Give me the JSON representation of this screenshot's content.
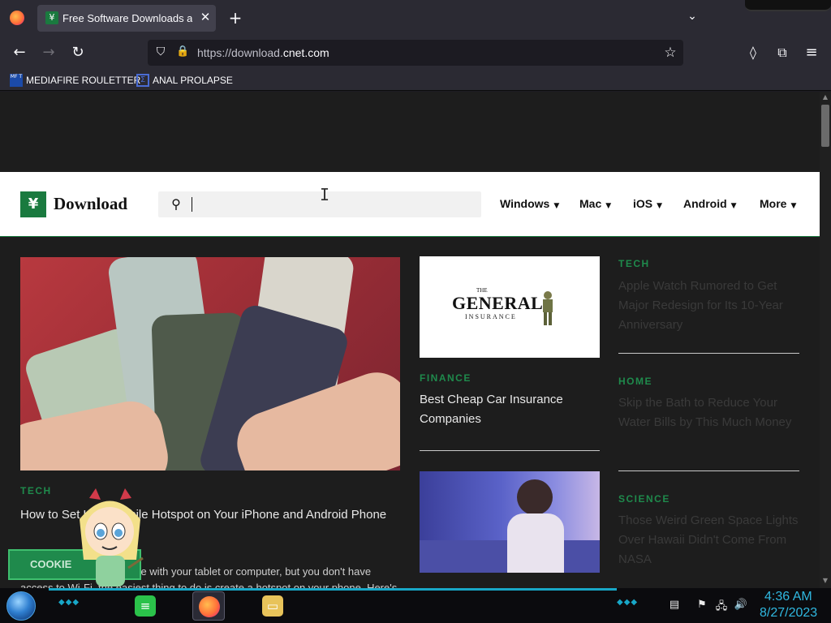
{
  "tab": {
    "title": "Free Software Downloads and Reviews for Windows, Android, Mac, and iOS - CNET Download",
    "close": "✕",
    "favicon": "¥"
  },
  "tabstrip": {
    "newtab": "+",
    "list": "⌄"
  },
  "nav": {
    "back": "←",
    "forward": "→",
    "reload": "↻",
    "menu": "≡",
    "pocket": "◊",
    "extensions": "⧉"
  },
  "url": {
    "prefix": "https://download.",
    "host": "cnet.com",
    "full": "https://download.cnet.com"
  },
  "bookmarks": [
    {
      "label": "MEDIAFIRE ROULETTER",
      "icon": "MF T"
    },
    {
      "label": "ANAL PROLAPSE",
      "icon": "Σ"
    }
  ],
  "site": {
    "logo_text": "Download",
    "logo_glyph": "¥",
    "search_icon": "🔍",
    "nav": [
      "Windows",
      "Mac",
      "iOS",
      "Android",
      "More"
    ],
    "caret": "▼"
  },
  "articles": {
    "hero": {
      "category": "TECH",
      "headline": "How to Set Up a Mobile Hotspot on Your iPhone and Android Phone",
      "snippet": "If you're trying to get online with your tablet or computer, but you don't have access to Wi-Fi, the easiest thing to do is create a hotspot on your phone. Here's how."
    },
    "finance": {
      "category": "FINANCE",
      "headline": "Best Cheap Car Insurance Companies"
    },
    "side": [
      {
        "category": "TECH",
        "headline": "Apple Watch Rumored to Get Major Redesign for Its 10-Year Anniversary"
      },
      {
        "category": "HOME",
        "headline": "Skip the Bath to Reduce Your Water Bills by This Much Money"
      },
      {
        "category": "SCIENCE",
        "headline": "Those Weird Green Space Lights Over Hawaii Didn't Come From NASA"
      }
    ]
  },
  "ad": {
    "brand": "GENERAL",
    "brand_prefix": "THE",
    "sub": "INSURANCE"
  },
  "cookie": {
    "label": "COOKIE"
  },
  "taskbar": {
    "time": "4:36 AM",
    "date": "8/27/2023"
  },
  "colors": {
    "accent": "#1a7a3f",
    "category": "#1f8a4c",
    "clock": "#30b8e0"
  }
}
